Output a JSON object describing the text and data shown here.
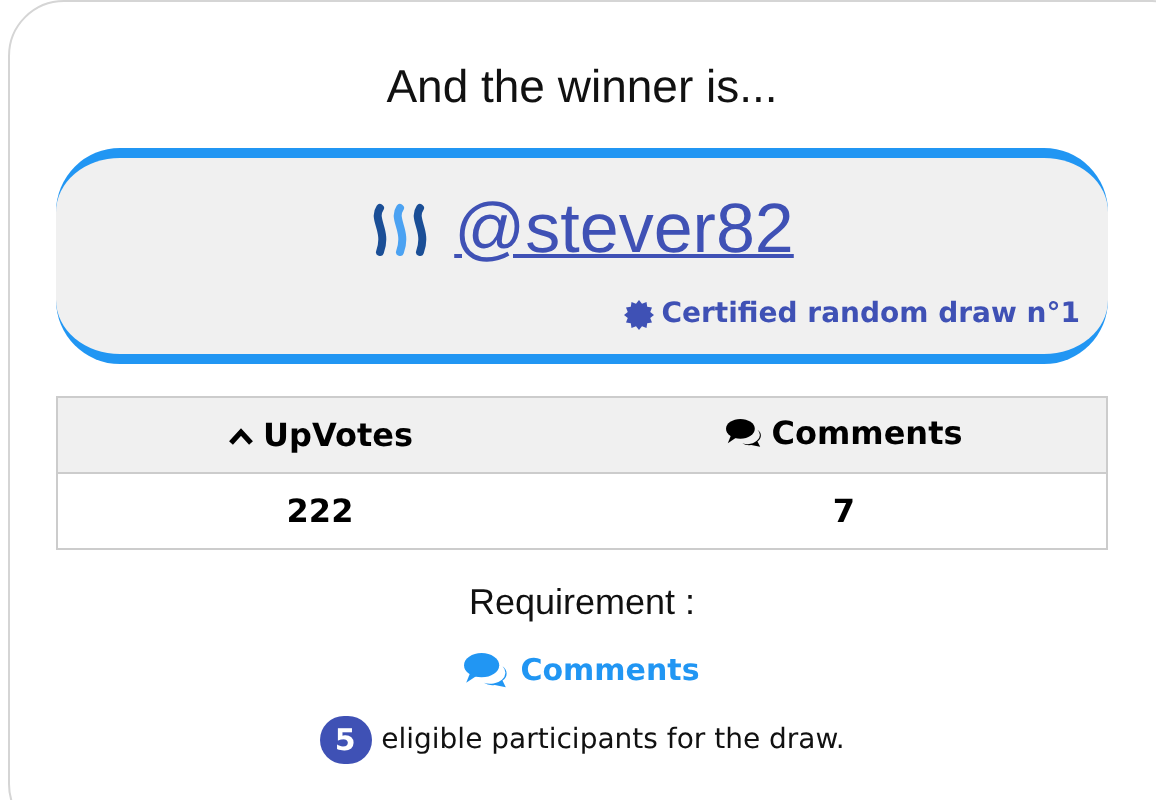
{
  "heading": "And the winner is...",
  "winner": {
    "username": "@stever82",
    "certificate": "Certified random draw n°1"
  },
  "stats": {
    "columns": [
      {
        "label": "UpVotes",
        "kind": "votes"
      },
      {
        "label": "Comments",
        "kind": "comments"
      }
    ],
    "values": [
      "222",
      "7"
    ]
  },
  "requirement": {
    "label": "Requirement :",
    "item": "Comments"
  },
  "eligible": {
    "count": "5",
    "text": "eligible participants for the draw."
  }
}
